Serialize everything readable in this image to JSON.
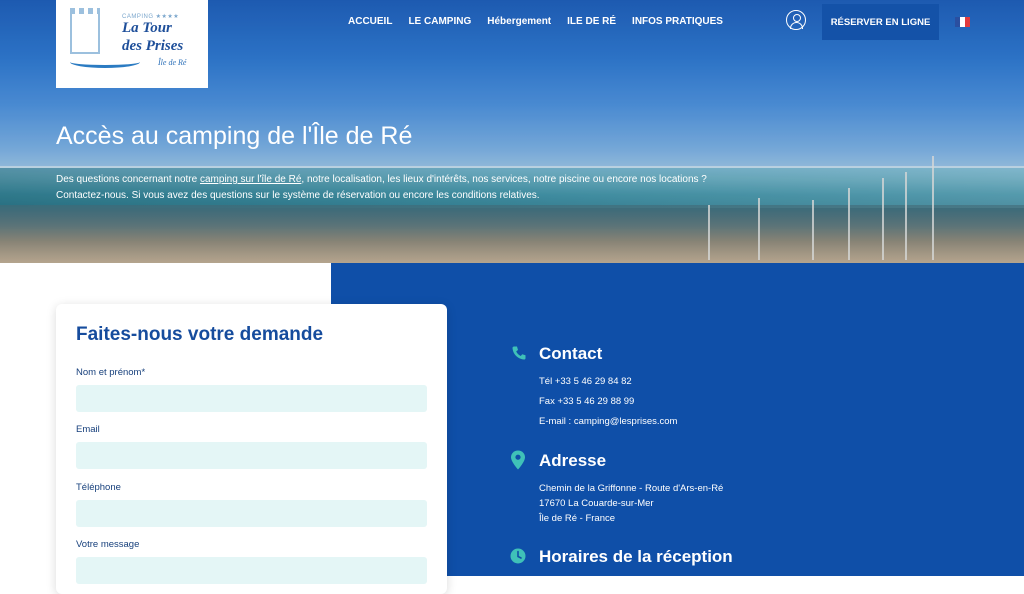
{
  "logo": {
    "camping": "CAMPING ★★★★",
    "line1": "La Tour",
    "line2": "des Prises",
    "sub": "Île de Ré"
  },
  "nav": {
    "items": [
      "ACCUEIL",
      "LE CAMPING",
      "Hébergement",
      "ILE DE RÉ",
      "INFOS PRATIQUES"
    ],
    "book_label": "RÉSERVER EN LIGNE",
    "account_icon": "user-circle-icon",
    "language_icon": "french-flag-icon"
  },
  "hero": {
    "title": "Accès au camping de l'Île de  Ré",
    "text_before": "Des questions concernant notre ",
    "text_link": "camping sur l'île de Ré",
    "text_after": ", notre localisation, les lieux d'intérêts, nos services, notre piscine ou encore nos locations ?",
    "text_line2": "Contactez-nous. Si vous avez des questions sur le système de réservation ou encore les conditions relatives."
  },
  "form": {
    "title": "Faites-nous votre demande",
    "fields": [
      {
        "label": "Nom et prénom*",
        "value": ""
      },
      {
        "label": "Email",
        "value": ""
      },
      {
        "label": "Téléphone",
        "value": ""
      },
      {
        "label": "Votre message",
        "value": ""
      }
    ]
  },
  "contact": {
    "title": "Contact",
    "icon": "phone-icon",
    "lines": [
      "Tél +33 5 46 29 84 82",
      "Fax +33 5 46 29 88 99",
      "E-mail : camping@lesprises.com"
    ]
  },
  "address": {
    "title": "Adresse",
    "icon": "map-pin-icon",
    "lines": [
      "Chemin de la Griffonne - Route d'Ars-en-Ré",
      "17670 La Couarde-sur-Mer",
      "Île de Ré - France"
    ]
  },
  "hours": {
    "title": "Horaires de la réception",
    "icon": "clock-icon"
  },
  "colors": {
    "brand_blue": "#0f4fa8",
    "button_blue": "#1452a8",
    "title_blue": "#164c9d",
    "input_bg": "#e4f6f6",
    "icon_teal": "#3fc1b8"
  }
}
